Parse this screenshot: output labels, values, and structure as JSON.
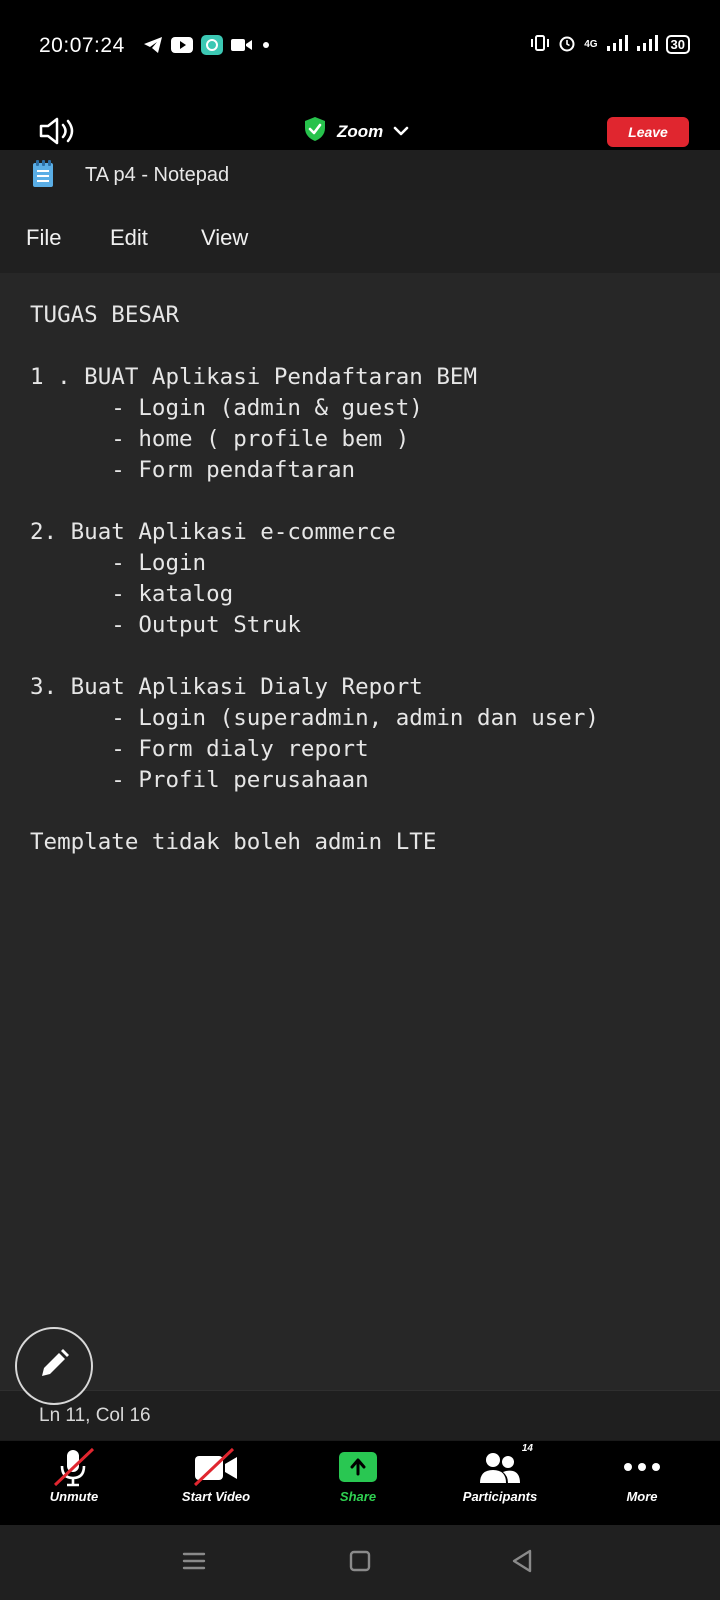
{
  "status_bar": {
    "time": "20:07:24",
    "app_icons": [
      "telegram-icon",
      "youtube-icon",
      "chat-app-icon",
      "video-camera-icon",
      "dot-icon"
    ],
    "network": "4G",
    "battery": "30"
  },
  "zoom_header": {
    "title": "Zoom",
    "leave_label": "Leave",
    "accent_green": "#27c24c",
    "leave_color": "#e0262f"
  },
  "notepad": {
    "window_title": "TA p4 - Notepad",
    "menu": [
      "File",
      "Edit",
      "View"
    ],
    "content": "TUGAS BESAR\n\n1 . BUAT Aplikasi Pendaftaran BEM\n      - Login (admin & guest)\n      - home ( profile bem )\n      - Form pendaftaran\n\n2. Buat Aplikasi e-commerce\n      - Login\n      - katalog\n      - Output Struk\n\n3. Buat Aplikasi Dialy Report\n      - Login (superadmin, admin dan user)\n      - Form dialy report\n      - Profil perusahaan\n\nTemplate tidak boleh admin LTE",
    "status": "Ln 11, Col 16"
  },
  "toolbar": {
    "unmute": "Unmute",
    "start_video": "Start Video",
    "share": "Share",
    "participants": "Participants",
    "participant_count": "14",
    "more": "More"
  }
}
